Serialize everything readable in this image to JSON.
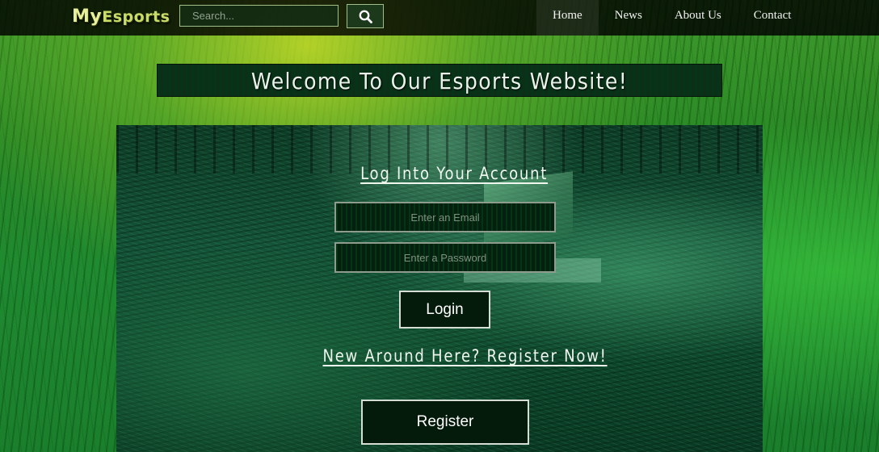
{
  "navbar": {
    "brand_my": "My",
    "brand_esports": "Esports",
    "search_placeholder": "Search...",
    "links": [
      {
        "label": "Home"
      },
      {
        "label": "News"
      },
      {
        "label": "About Us"
      },
      {
        "label": "Contact"
      }
    ]
  },
  "welcome": {
    "title": "Welcome To Our Esports Website!"
  },
  "login": {
    "heading": "Log Into Your Account",
    "email_placeholder": "Enter an Email",
    "password_placeholder": "Enter a Password",
    "button_label": "Login"
  },
  "register": {
    "heading": "New Around Here? Register Now!",
    "button_label": "Register"
  },
  "icons": {
    "search": "search-icon"
  },
  "colors": {
    "navbar_bg": "#000000",
    "brand": "#cfe36a",
    "button_bg": "#041a0b",
    "button_border": "#d5ddd5",
    "text": "#eef6ee"
  }
}
